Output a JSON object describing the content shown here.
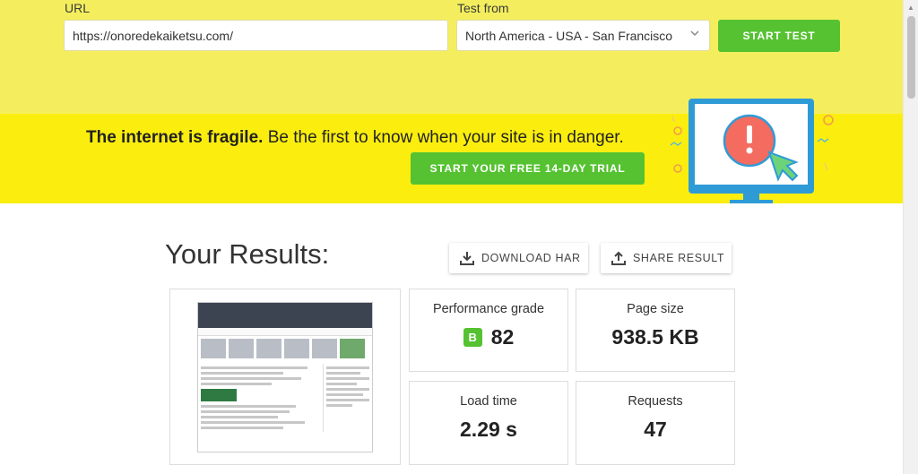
{
  "form": {
    "url_label": "URL",
    "url_value": "https://onoredekaiketsu.com/",
    "test_from_label": "Test from",
    "test_from_value": "North America - USA - San Francisco",
    "start_button": "START TEST"
  },
  "promo": {
    "headline_bold": "The internet is fragile.",
    "headline_rest": " Be the first to know when your site is in danger.",
    "trial_button": "START YOUR FREE 14-DAY TRIAL"
  },
  "results": {
    "title": "Your Results:",
    "download_button": "DOWNLOAD HAR",
    "share_button": "SHARE RESULT",
    "metrics": {
      "performance": {
        "label": "Performance grade",
        "grade": "B",
        "value": "82"
      },
      "page_size": {
        "label": "Page size",
        "value": "938.5 KB"
      },
      "load_time": {
        "label": "Load time",
        "value": "2.29 s"
      },
      "requests": {
        "label": "Requests",
        "value": "47"
      }
    }
  },
  "colors": {
    "form_band": "#f4ee5e",
    "promo_band": "#fbee0f",
    "accent_green": "#56c232"
  }
}
